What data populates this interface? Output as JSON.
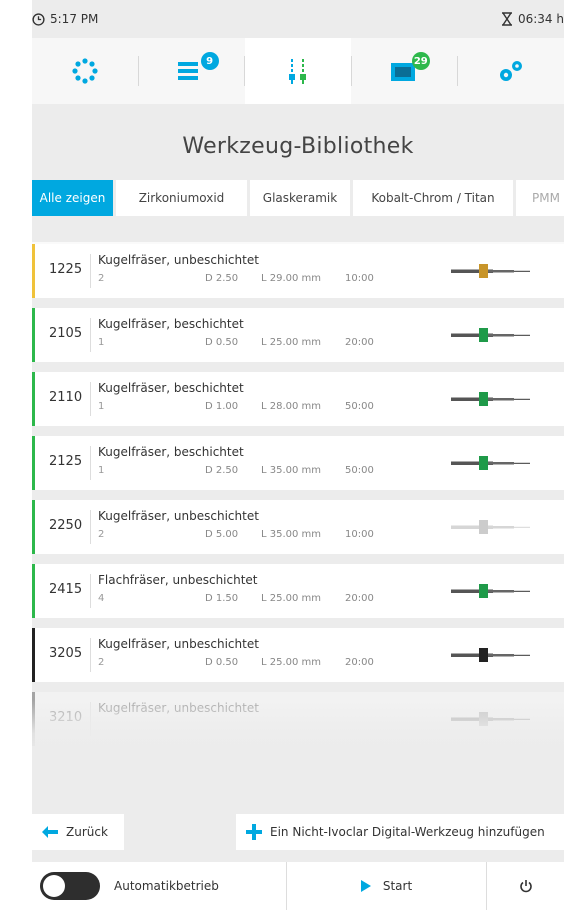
{
  "status": {
    "clock": "5:17 PM",
    "remaining": "06:34 h"
  },
  "nav": {
    "items": [
      {
        "name": "machine",
        "icon": "cluster-circle-icon"
      },
      {
        "name": "jobs",
        "icon": "list-icon",
        "badge": "9",
        "badge_color": "#00a8e0"
      },
      {
        "name": "tools",
        "icon": "milling-tools-icon",
        "active": true
      },
      {
        "name": "blanks",
        "icon": "blank-holder-icon",
        "badge": "29",
        "badge_color": "#2db84b"
      },
      {
        "name": "settings",
        "icon": "gears-icon"
      }
    ]
  },
  "page_title": "Werkzeug-Bibliothek",
  "tabs": [
    {
      "label": "Alle zeigen",
      "active": true
    },
    {
      "label": "Zirkoniumoxid"
    },
    {
      "label": "Glaskeramik"
    },
    {
      "label": "Kobalt-Chrom / Titan"
    },
    {
      "label": "PMM"
    }
  ],
  "tools": [
    {
      "number": "1225",
      "name": "Kugelfräser, unbeschichtet",
      "count": "2",
      "diameter": "D 2.50",
      "length": "L 29.00 mm",
      "time": "10:00",
      "color": "#c8952a",
      "accent": "#f0c23a"
    },
    {
      "number": "2105",
      "name": "Kugelfräser, beschichtet",
      "count": "1",
      "diameter": "D 0.50",
      "length": "L 25.00 mm",
      "time": "20:00",
      "color": "#1f9a49",
      "accent": "#2db84b"
    },
    {
      "number": "2110",
      "name": "Kugelfräser, beschichtet",
      "count": "1",
      "diameter": "D 1.00",
      "length": "L 28.00 mm",
      "time": "50:00",
      "color": "#1f9a49",
      "accent": "#2db84b"
    },
    {
      "number": "2125",
      "name": "Kugelfräser, beschichtet",
      "count": "1",
      "diameter": "D 2.50",
      "length": "L 35.00 mm",
      "time": "50:00",
      "color": "#1f9a49",
      "accent": "#2db84b"
    },
    {
      "number": "2250",
      "name": "Kugelfräser, unbeschichtet",
      "count": "2",
      "diameter": "D 5.00",
      "length": "L 35.00 mm",
      "time": "10:00",
      "color": "#cccccc",
      "accent": "#2db84b"
    },
    {
      "number": "2415",
      "name": "Flachfräser, unbeschichtet",
      "count": "4",
      "diameter": "D 1.50",
      "length": "L 25.00 mm",
      "time": "20:00",
      "color": "#1f9a49",
      "accent": "#2db84b"
    },
    {
      "number": "3205",
      "name": "Kugelfräser, unbeschichtet",
      "count": "2",
      "diameter": "D 0.50",
      "length": "L 25.00 mm",
      "time": "20:00",
      "color": "#222222",
      "accent": "#222222"
    },
    {
      "number": "3210",
      "name": "Kugelfräser, unbeschichtet",
      "count": "",
      "diameter": "",
      "length": "",
      "time": "",
      "color": "#888888",
      "accent": "#222222"
    }
  ],
  "buttons": {
    "back": "Zurück",
    "add_tool": "Ein Nicht-Ivoclar Digital-Werkzeug hinzufügen",
    "auto_mode": "Automatikbetrieb",
    "start": "Start"
  },
  "colors": {
    "accent_blue": "#00a8e0",
    "coated_green": "#2db84b"
  }
}
